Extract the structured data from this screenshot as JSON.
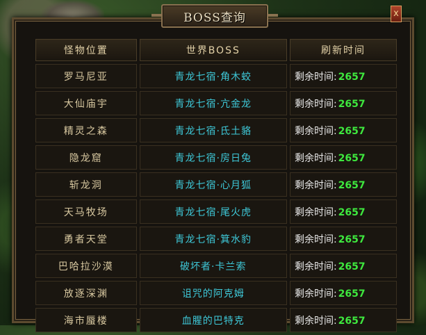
{
  "window": {
    "title": "BOSS查询",
    "close_label": "x"
  },
  "table": {
    "headers": [
      "怪物位置",
      "世界BOSS",
      "刷新时间"
    ],
    "rows": [
      {
        "location": "罗马尼亚",
        "boss": "青龙七宿·角木蛟",
        "time_label": "剩余时间:",
        "time_value": "2657"
      },
      {
        "location": "大仙庙宇",
        "boss": "青龙七宿·亢金龙",
        "time_label": "剩余时间:",
        "time_value": "2657"
      },
      {
        "location": "精灵之森",
        "boss": "青龙七宿·氐土貉",
        "time_label": "剩余时间:",
        "time_value": "2657"
      },
      {
        "location": "隐龙窟",
        "boss": "青龙七宿·房日兔",
        "time_label": "剩余时间:",
        "time_value": "2657"
      },
      {
        "location": "斩龙洞",
        "boss": "青龙七宿·心月狐",
        "time_label": "剩余时间:",
        "time_value": "2657"
      },
      {
        "location": "天马牧场",
        "boss": "青龙七宿·尾火虎",
        "time_label": "剩余时间:",
        "time_value": "2657"
      },
      {
        "location": "勇者天堂",
        "boss": "青龙七宿·箕水豹",
        "time_label": "剩余时间:",
        "time_value": "2657"
      },
      {
        "location": "巴哈拉沙漠",
        "boss": "破坏者·卡兰索",
        "time_label": "剩余时间:",
        "time_value": "2657"
      },
      {
        "location": "放逐深渊",
        "boss": "诅咒的阿克姆",
        "time_label": "剩余时间:",
        "time_value": "2657"
      },
      {
        "location": "海市蜃楼",
        "boss": "血腥的巴特克",
        "time_label": "剩余时间:",
        "time_value": "2657"
      }
    ]
  },
  "colors": {
    "boss_name": "#3ec8d8",
    "time_value": "#3ee83e",
    "location": "#d8c8a0"
  }
}
